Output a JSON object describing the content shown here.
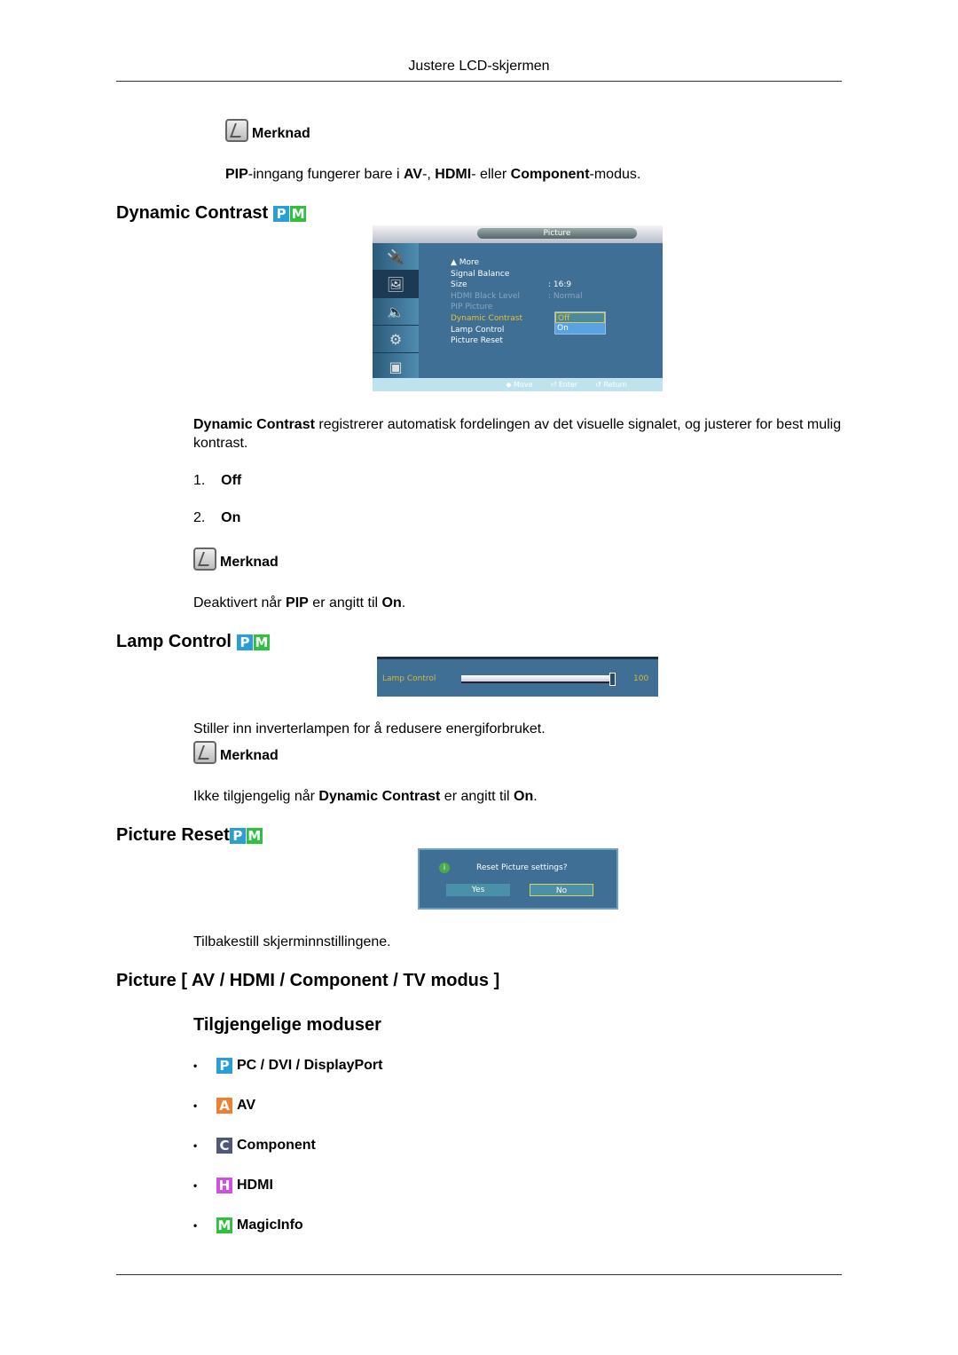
{
  "header": {
    "title": "Justere LCD-skjermen"
  },
  "note1": {
    "label": "Merknad",
    "pre_bold": "PIP",
    "text1": "-inngang fungerer bare i ",
    "b1": "AV",
    "text2": "-, ",
    "b2": "HDMI",
    "text3": "- eller ",
    "b3": "Component",
    "text4": "-modus."
  },
  "dynamic_contrast": {
    "title": "Dynamic Contrast",
    "badges": [
      "P",
      "M"
    ],
    "osd": {
      "title": "Picture",
      "items": [
        "▲ More",
        "Signal Balance",
        "Size",
        "HDMI Black Level",
        "PIP Picture",
        "Dynamic Contrast",
        "Lamp Control",
        "Picture Reset"
      ],
      "size_value": "16:9",
      "hdmi_black_value": "Normal",
      "dropdown": [
        "Off",
        "On"
      ],
      "footer": [
        "Move",
        "Enter",
        "Return"
      ]
    },
    "desc_bold": "Dynamic Contrast",
    "desc": " registrerer automatisk fordelingen av det visuelle signalet, og justerer for best mulig kontrast.",
    "options": [
      {
        "num": "1.",
        "label": "Off"
      },
      {
        "num": "2.",
        "label": "On"
      }
    ],
    "note_label": "Merknad",
    "note_t1": "Deaktivert når ",
    "note_b1": "PIP",
    "note_t2": " er angitt til ",
    "note_b2": "On",
    "note_t3": "."
  },
  "lamp_control": {
    "title": "Lamp Control",
    "badges": [
      "P",
      "M"
    ],
    "osd_label": "Lamp Control",
    "value": "100",
    "value_fraction": 1.0,
    "desc": "Stiller inn inverterlampen for å redusere energiforbruket.",
    "note_label": "Merknad",
    "note_t1": "Ikke tilgjengelig når ",
    "note_b1": "Dynamic Contrast",
    "note_t2": " er angitt til ",
    "note_b2": "On",
    "note_t3": "."
  },
  "picture_reset": {
    "title": "Picture Reset",
    "badges": [
      "P",
      "M"
    ],
    "dialog_question": "Reset Picture settings?",
    "yes": "Yes",
    "no": "No",
    "desc": "Tilbakestill skjerminnstillingene."
  },
  "picture_av": {
    "title": "Picture [ AV / HDMI / Component / TV modus ]",
    "subtitle": "Tilgjengelige moduser",
    "modes": [
      {
        "badge": "P",
        "color": "#2a9fd6",
        "label": "PC / DVI / DisplayPort"
      },
      {
        "badge": "A",
        "color": "#f08030",
        "label": "AV"
      },
      {
        "badge": "C",
        "color": "#505878",
        "label": "Component"
      },
      {
        "badge": "H",
        "color": "#d050e0",
        "label": "HDMI"
      },
      {
        "badge": "M",
        "color": "#30c040",
        "label": "MagicInfo"
      }
    ]
  },
  "colors": {
    "badge_p": "#2a9fd6",
    "badge_m": "#30c040",
    "osd_bg": "#3f6f95",
    "osd_highlight": "#e8c030"
  }
}
